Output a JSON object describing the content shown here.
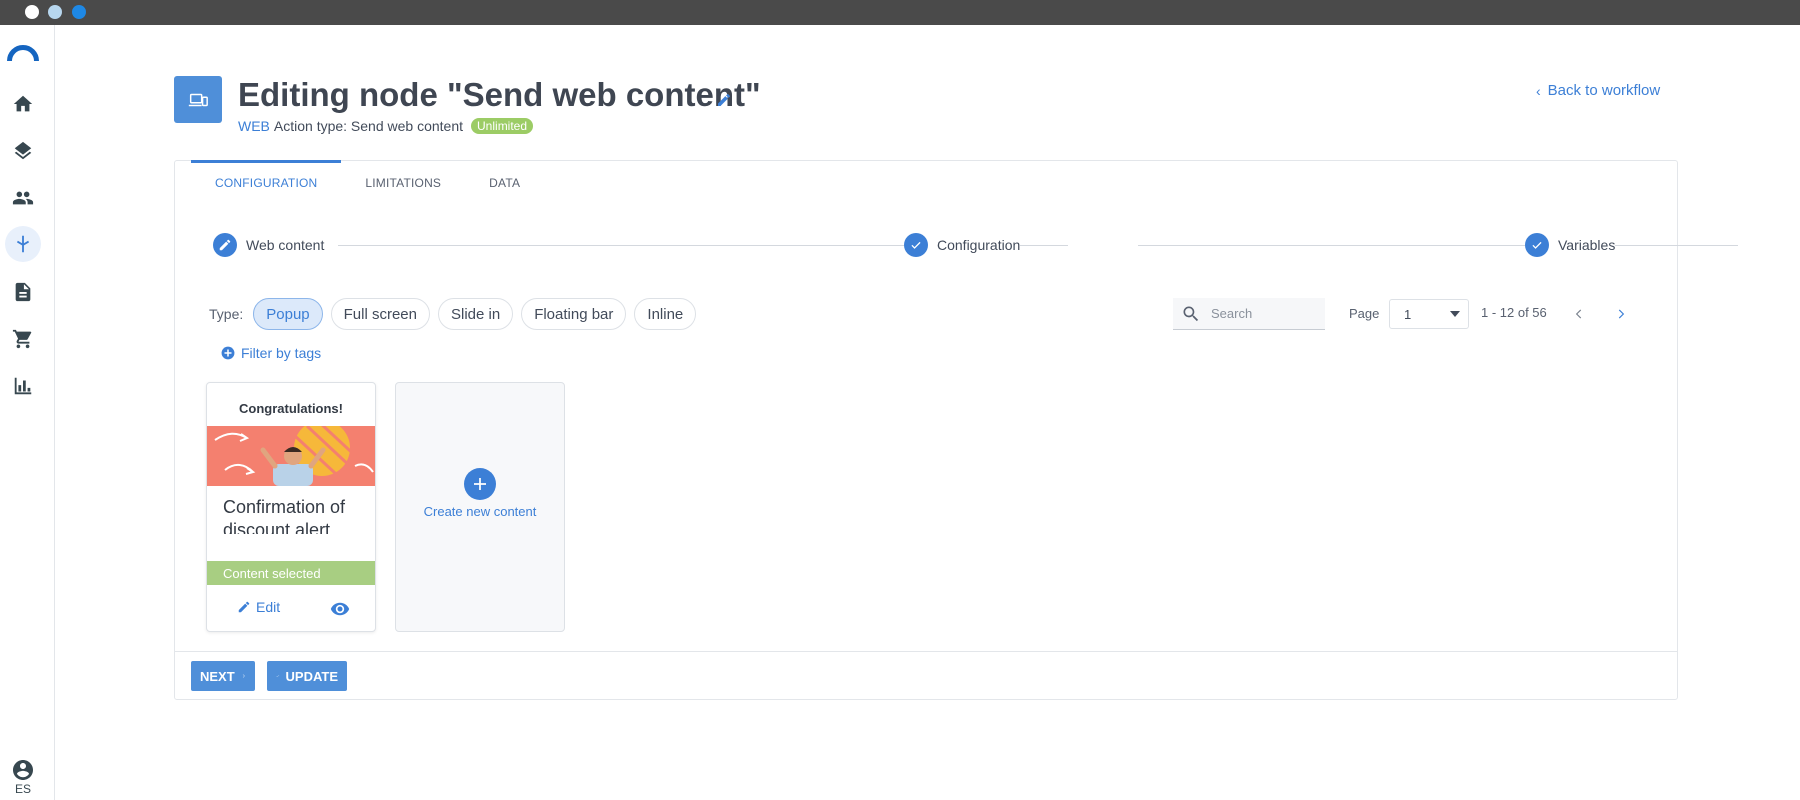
{
  "app": {
    "lang": "ES",
    "colors": {
      "primary": "#3c7fd6",
      "success": "#9ccc65",
      "selected_bar": "#a8ce82"
    },
    "sidebar_icons": [
      "home-icon",
      "layers-icon",
      "people-icon",
      "workflow-icon",
      "document-icon",
      "cart-icon",
      "chart-icon"
    ],
    "active_sidebar": "workflow-icon"
  },
  "header": {
    "title": "Editing node \"Send web content\"",
    "channel": "WEB",
    "action_type": "Action type: Send web content",
    "badge": "Unlimited",
    "back_label": "Back to workflow"
  },
  "tabs": [
    {
      "label": "CONFIGURATION",
      "active": true
    },
    {
      "label": "LIMITATIONS",
      "active": false
    },
    {
      "label": "DATA",
      "active": false
    }
  ],
  "steps": [
    {
      "label": "Web content",
      "icon": "pencil-icon"
    },
    {
      "label": "Configuration",
      "icon": "check-icon"
    },
    {
      "label": "Variables",
      "icon": "check-icon"
    }
  ],
  "filters": {
    "type_label": "Type:",
    "types": [
      {
        "label": "Popup",
        "active": true
      },
      {
        "label": "Full screen",
        "active": false
      },
      {
        "label": "Slide in",
        "active": false
      },
      {
        "label": "Floating bar",
        "active": false
      },
      {
        "label": "Inline",
        "active": false
      }
    ],
    "filter_tags_label": "Filter by tags"
  },
  "search": {
    "placeholder": "Search"
  },
  "pagination": {
    "label": "Page",
    "current": "1",
    "range": "1 - 12 of 56"
  },
  "cards": [
    {
      "header": "Congratulations!",
      "heading": "Confirmation of discount alert",
      "status": "Content selected",
      "edit_label": "Edit"
    }
  ],
  "create_card": {
    "label": "Create new content"
  },
  "actions": {
    "next_label": "NEXT",
    "update_label": "UPDATE"
  }
}
